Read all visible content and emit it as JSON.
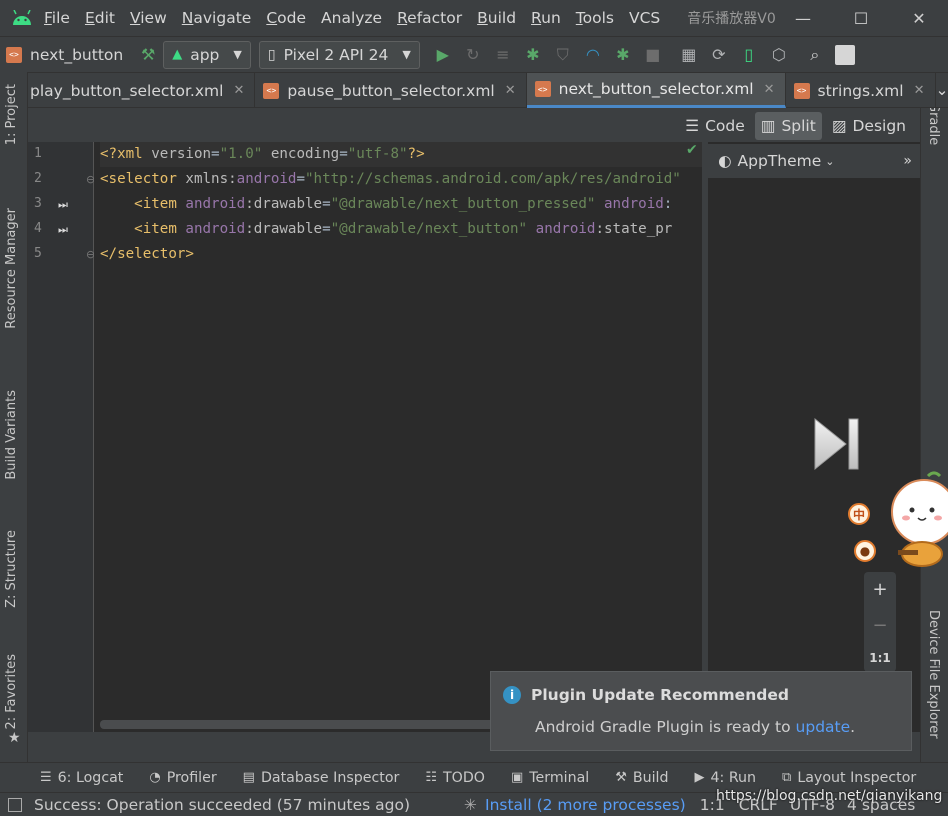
{
  "menu": {
    "items": [
      {
        "label": "File",
        "u": "F",
        "rest": "ile"
      },
      {
        "label": "Edit",
        "u": "E",
        "rest": "dit"
      },
      {
        "label": "View",
        "u": "V",
        "rest": "iew"
      },
      {
        "label": "Navigate",
        "u": "N",
        "rest": "avigate"
      },
      {
        "label": "Code",
        "u": "C",
        "rest": "ode"
      },
      {
        "label": "Analyze",
        "u": "",
        "rest": "Analyze"
      },
      {
        "label": "Refactor",
        "u": "R",
        "rest": "efactor"
      },
      {
        "label": "Build",
        "u": "B",
        "rest": "uild"
      },
      {
        "label": "Run",
        "u": "R",
        "rest": "un"
      },
      {
        "label": "Tools",
        "u": "T",
        "rest": "ools"
      },
      {
        "label": "VCS",
        "u": "",
        "rest": "VCS"
      }
    ],
    "window_title": "音乐播放器V0"
  },
  "toolbar": {
    "breadcrumb": "next_button",
    "module": "app",
    "device": "Pixel 2 API 24"
  },
  "tabs": [
    {
      "label": "play_button_selector.xml",
      "active": false
    },
    {
      "label": "pause_button_selector.xml",
      "active": false
    },
    {
      "label": "next_button_selector.xml",
      "active": true
    },
    {
      "label": "strings.xml",
      "active": false
    }
  ],
  "view_modes": {
    "code": "Code",
    "split": "Split",
    "design": "Design"
  },
  "side_tools": {
    "left": [
      "1: Project",
      "Resource Manager",
      "Build Variants",
      "Z: Structure",
      "2: Favorites"
    ],
    "right_top": "Gradle",
    "right_bottom": "Device File Explorer"
  },
  "editor": {
    "line_numbers": [
      "1",
      "2",
      "3",
      "4",
      "5"
    ],
    "lines": [
      [
        {
          "c": "tag",
          "t": "<?xml "
        },
        {
          "c": "attr",
          "t": "version"
        },
        {
          "c": "plain",
          "t": "="
        },
        {
          "c": "str",
          "t": "\"1.0\""
        },
        {
          "c": "attr",
          "t": " encoding"
        },
        {
          "c": "plain",
          "t": "="
        },
        {
          "c": "str",
          "t": "\"utf-8\""
        },
        {
          "c": "tag",
          "t": "?>"
        }
      ],
      [
        {
          "c": "tag",
          "t": "<selector "
        },
        {
          "c": "attr",
          "t": "xmlns:"
        },
        {
          "c": "ns",
          "t": "android"
        },
        {
          "c": "plain",
          "t": "="
        },
        {
          "c": "str",
          "t": "\"http://schemas.android.com/apk/res/android\""
        }
      ],
      [
        {
          "c": "plain",
          "t": "    "
        },
        {
          "c": "tag",
          "t": "<item "
        },
        {
          "c": "ns",
          "t": "android"
        },
        {
          "c": "attr",
          "t": ":drawable"
        },
        {
          "c": "plain",
          "t": "="
        },
        {
          "c": "str",
          "t": "\"@drawable/next_button_pressed\""
        },
        {
          "c": "plain",
          "t": " "
        },
        {
          "c": "ns",
          "t": "android"
        },
        {
          "c": "plain",
          "t": ":"
        }
      ],
      [
        {
          "c": "plain",
          "t": "    "
        },
        {
          "c": "tag",
          "t": "<item "
        },
        {
          "c": "ns",
          "t": "android"
        },
        {
          "c": "attr",
          "t": ":drawable"
        },
        {
          "c": "plain",
          "t": "="
        },
        {
          "c": "str",
          "t": "\"@drawable/next_button\""
        },
        {
          "c": "plain",
          "t": " "
        },
        {
          "c": "ns",
          "t": "android"
        },
        {
          "c": "attr",
          "t": ":state_pr"
        }
      ],
      [
        {
          "c": "tag",
          "t": "</selector>"
        }
      ]
    ]
  },
  "preview": {
    "theme": "AppTheme",
    "zoom_in": "+",
    "zoom_out": "−",
    "zoom_reset": "1:1",
    "ime_badge": "中"
  },
  "notification": {
    "title": "Plugin Update Recommended",
    "body_prefix": "Android Gradle Plugin is ready to ",
    "body_link": "update",
    "body_suffix": "."
  },
  "bottom_tools": [
    {
      "icon": "logcat-icon",
      "glyph": "☰",
      "label": "6: Logcat"
    },
    {
      "icon": "profiler-icon",
      "glyph": "◔",
      "label": "Profiler"
    },
    {
      "icon": "database-icon",
      "glyph": "▤",
      "label": "Database Inspector"
    },
    {
      "icon": "todo-icon",
      "glyph": "☷",
      "label": "TODO"
    },
    {
      "icon": "terminal-icon",
      "glyph": "▣",
      "label": "Terminal"
    },
    {
      "icon": "build-icon",
      "glyph": "⚒",
      "label": "Build"
    },
    {
      "icon": "run-icon",
      "glyph": "▶",
      "label": "4: Run"
    },
    {
      "icon": "layout-inspector-icon",
      "glyph": "⧉",
      "label": "Layout Inspector"
    }
  ],
  "status": {
    "message": "Success: Operation succeeded (57 minutes ago)",
    "progress": "Install (2 more processes)",
    "position": "1:1",
    "line_sep": "CRLF",
    "encoding": "UTF-8",
    "indent": "4 spaces",
    "watermark": "https://blog.csdn.net/qianyikang"
  },
  "colors": {
    "accent": "#4a88c7",
    "run_green": "#59a869",
    "android_green": "#3ddc84",
    "link": "#589df6"
  }
}
